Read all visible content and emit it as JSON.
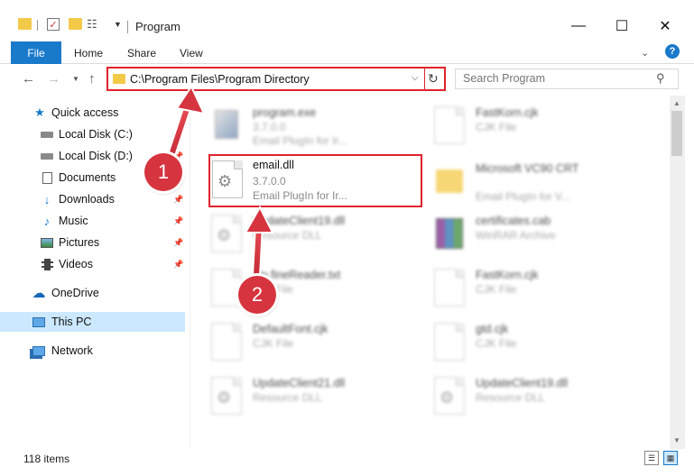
{
  "window": {
    "title": "Program",
    "minimize_glyph": "—",
    "maximize_glyph": "☐",
    "close_glyph": "✕"
  },
  "ribbon": {
    "tabs": [
      "File",
      "Home",
      "Share",
      "View"
    ],
    "expand_glyph": "⌄",
    "help_glyph": "?"
  },
  "address": {
    "path": "C:\\Program Files\\Program Directory",
    "search_placeholder": "Search Program"
  },
  "sidebar": {
    "items": [
      {
        "label": "Quick access",
        "icon": "star-icon",
        "pinned": false
      },
      {
        "label": "Local Disk (C:)",
        "icon": "drive-icon",
        "pinned": true
      },
      {
        "label": "Local Disk (D:)",
        "icon": "drive-icon",
        "pinned": true
      },
      {
        "label": "Documents",
        "icon": "documents-icon",
        "pinned": true
      },
      {
        "label": "Downloads",
        "icon": "download-icon",
        "pinned": true
      },
      {
        "label": "Music",
        "icon": "music-icon",
        "pinned": true
      },
      {
        "label": "Pictures",
        "icon": "pictures-icon",
        "pinned": true
      },
      {
        "label": "Videos",
        "icon": "videos-icon",
        "pinned": true
      },
      {
        "label": "OneDrive",
        "icon": "cloud-icon",
        "pinned": false
      },
      {
        "label": "This PC",
        "icon": "computer-icon",
        "pinned": false,
        "selected": true
      },
      {
        "label": "Network",
        "icon": "network-icon",
        "pinned": false
      }
    ]
  },
  "files": [
    {
      "name": "program.exe",
      "line2": "3.7.0.0",
      "line3": "Email PlugIn for Ir...",
      "blurred": true
    },
    {
      "name": "FastKorn.cjk",
      "line2": "CJK File",
      "line3": "",
      "blurred": true
    },
    {
      "name": "email.dll",
      "line2": "3.7.0.0",
      "line3": "Email PlugIn for Ir...",
      "blurred": false,
      "highlighted": true
    },
    {
      "name": "Microsoft VC90 CRT",
      "line2": "",
      "line3": "Email PlugIn for V...",
      "blurred": true
    },
    {
      "name": "UpdateClient19.dll",
      "line2": "Resource DLL",
      "line3": "",
      "blurred": true
    },
    {
      "name": "certificates.cab",
      "line2": "WinRAR Archive",
      "line3": "",
      "blurred": true
    },
    {
      "name": "hlp.fineReader.txt",
      "line2": "Text File",
      "line3": "",
      "blurred": true
    },
    {
      "name": "FastKorn.cjk",
      "line2": "CJK File",
      "line3": "",
      "blurred": true
    },
    {
      "name": "DefaultFont.cjk",
      "line2": "CJK File",
      "line3": "",
      "blurred": true
    },
    {
      "name": "gtd.cjk",
      "line2": "CJK File",
      "line3": "",
      "blurred": true
    },
    {
      "name": "UpdateClient21.dll",
      "line2": "Resource DLL",
      "line3": "",
      "blurred": true
    },
    {
      "name": "UpdateClient19.dll",
      "line2": "Resource DLL",
      "line3": "",
      "blurred": true
    }
  ],
  "status": {
    "item_count": "118 items"
  },
  "annotations": {
    "step1": "1",
    "step2": "2"
  },
  "colors": {
    "accent": "#1979ca",
    "highlight_red": "#e0232d",
    "step_red": "#d6343f",
    "selected_bg": "#cce8ff"
  }
}
